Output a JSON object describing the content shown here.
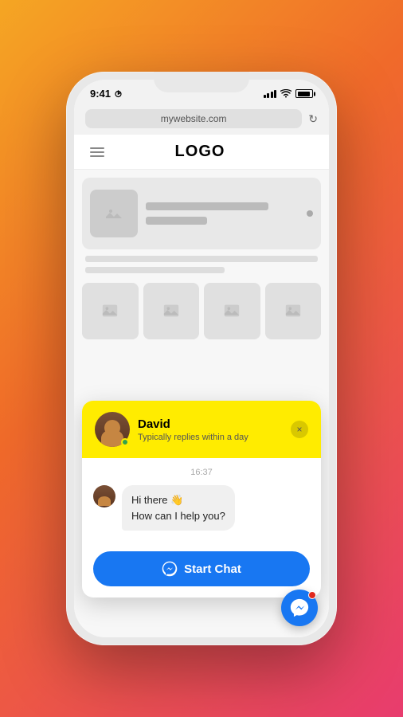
{
  "phone": {
    "status_bar": {
      "time": "9:41",
      "location_arrow": "▶",
      "battery_full": true
    },
    "browser": {
      "url": "mywebsite.com",
      "reload_symbol": "↻"
    },
    "nav": {
      "logo": "LOGO"
    },
    "chat_popup": {
      "agent_name": "David",
      "agent_status": "Typically replies within a day",
      "close_symbol": "×",
      "timestamp": "16:37",
      "message_line1": "Hi there 👋",
      "message_line2": "How can I help you?",
      "start_chat_label": "Start Chat"
    }
  }
}
